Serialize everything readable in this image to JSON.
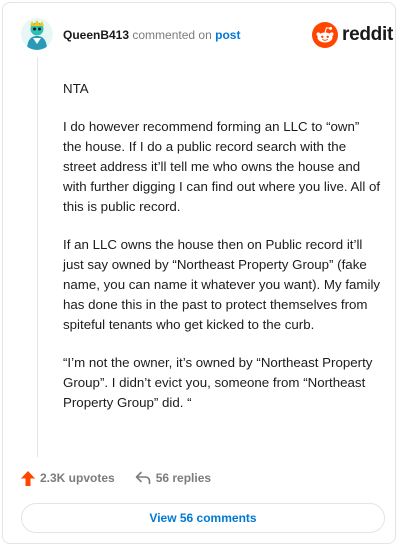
{
  "header": {
    "username": "QueenB413",
    "action_text": "commented on",
    "post_link": "post",
    "brand": "reddit"
  },
  "comment": {
    "paragraphs": [
      "NTA",
      "I do however recommend forming an LLC to “own” the house. If I do a public record search with the street address it’ll tell me who owns the house and with further digging I can find out where you live. All of this is public record.",
      "If an LLC owns the house then on Public record it’ll just say owned by “Northeast Property Group” (fake name, you can name it whatever you want). My family has done this in the past to protect themselves from spiteful tenants who get kicked to the curb.",
      "“I’m not the owner, it’s owned by “Northeast Property Group”. I didn’t evict you, someone from “Northeast Property Group” did. “"
    ]
  },
  "footer": {
    "upvotes": "2.3K upvotes",
    "replies": "56 replies",
    "view_button": "View 56 comments"
  },
  "colors": {
    "accent": "#ff4500",
    "link": "#0079d3",
    "muted": "#7c7c7c"
  },
  "icons": {
    "avatar": "avatar-icon",
    "brand": "reddit-logo-icon",
    "upvote": "upvote-arrow-icon",
    "reply": "reply-arrow-icon"
  }
}
